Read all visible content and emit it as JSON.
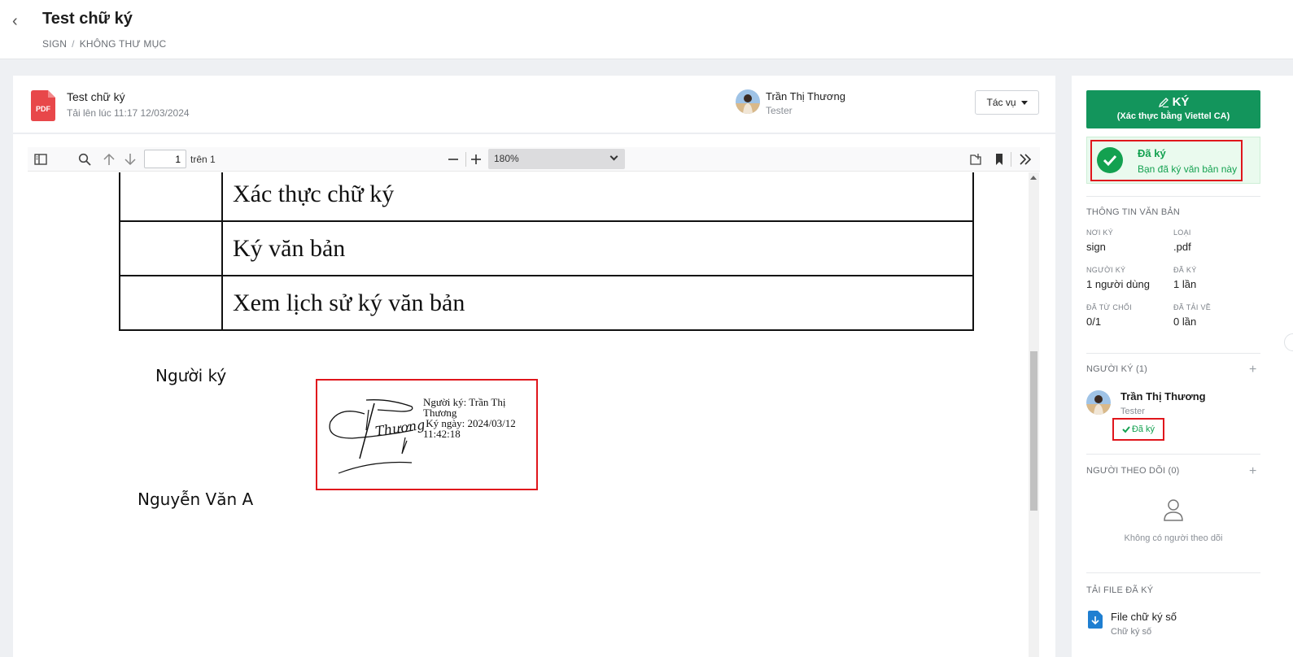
{
  "header": {
    "title": "Test chữ ký",
    "breadcrumb": [
      "SIGN",
      "KHÔNG THƯ MỤC"
    ],
    "back_icon": "chevron-left-icon"
  },
  "file": {
    "icon_label": "PDF",
    "name": "Test chữ ký",
    "uploaded": "Tải lên lúc 11:17 12/03/2024",
    "uploader_name": "Trần Thị Thương",
    "uploader_role": "Tester",
    "actions_label": "Tác vụ"
  },
  "viewer": {
    "page_current": "1",
    "page_of": "trên 1",
    "zoom": "180%",
    "icons": [
      "sidebar-toggle-icon",
      "search-icon",
      "arrow-up-icon",
      "arrow-down-icon",
      "zoom-out-icon",
      "zoom-in-icon",
      "open-file-icon",
      "bookmark-icon",
      "more-tools-icon"
    ]
  },
  "document": {
    "table_rows": [
      "Xác thực chữ ký",
      "Ký văn bản",
      "Xem lịch sử ký văn bản"
    ],
    "signer_label": "Người ký",
    "signer2_label": "Nguyễn Văn A",
    "signature": {
      "handwriting": "Thương",
      "line1": "Người ký: Trần Thị",
      "line2": "Thương",
      "line3": " Ký ngày: 2024/03/12",
      "line4": "11:42:18"
    }
  },
  "right_panel": {
    "sign_button": {
      "title": "KÝ",
      "subtitle": "(Xác thực bằng Viettel CA)"
    },
    "status": {
      "title": "Đã ký",
      "subtitle": "Bạn đã ký văn bản này"
    },
    "doc_info": {
      "title": "THÔNG TIN VĂN BẢN",
      "location_label": "NƠI KÝ",
      "location": "sign",
      "type_label": "LOẠI",
      "type": ".pdf",
      "signers_label": "NGƯỜI KÝ",
      "signers": "1 người dùng",
      "signed_label": "ĐÃ KÝ",
      "signed": "1 lần",
      "rejected_label": "ĐÃ TỪ CHỐI",
      "rejected": "0/1",
      "downloaded_label": "ĐÃ TẢI VỀ",
      "downloaded": "0 lần"
    },
    "signers_section": {
      "title": "NGƯỜI KÝ (1)",
      "name": "Trần Thị Thương",
      "role": "Tester",
      "badge": "Đã ký"
    },
    "followers_section": {
      "title": "NGƯỜI THEO DÕI (0)",
      "empty": "Không có người theo dõi"
    },
    "download_section": {
      "title": "TẢI FILE ĐÃ KÝ",
      "file_name": "File chữ ký số",
      "file_sub": "Chữ ký số"
    }
  },
  "colors": {
    "primary_green": "#13955c",
    "status_green": "#13a150",
    "highlight_red": "#e0161c",
    "pdf_red": "#e8474a"
  }
}
